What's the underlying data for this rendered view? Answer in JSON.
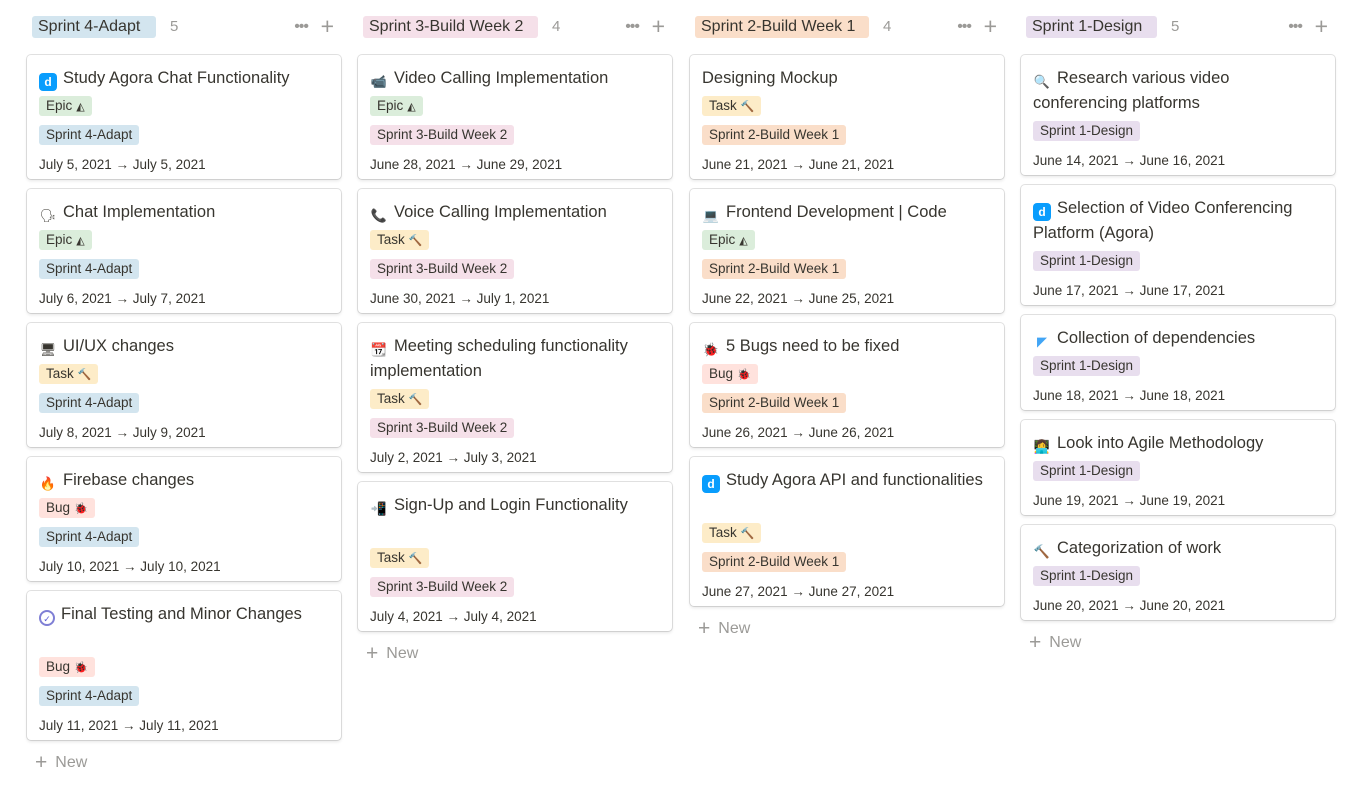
{
  "colors": {
    "sprint4": "#d3e5ef",
    "sprint3": "#f5e0e9",
    "sprint2": "#fadec9",
    "sprint1": "#e8deee",
    "epic": "#dbeddb",
    "task": "#fdecc8",
    "bug": "#ffe2dd"
  },
  "columns": [
    {
      "title": "Sprint 4-Adapt",
      "count": "5",
      "more_label": "•••",
      "add_label": "+",
      "new_label": "New",
      "cards": [
        {
          "icon": "agora-logo-icon",
          "glyph": "",
          "title": "Study Agora Chat Functionality",
          "tags": [
            {
              "label": "Epic",
              "glyph": "◭",
              "kind": "epic"
            },
            {
              "label": "Sprint 4-Adapt",
              "glyph": "",
              "kind": "sprint4"
            }
          ],
          "date": "July 5, 2021 → July 5, 2021"
        },
        {
          "icon": "speaking-head-icon",
          "glyph": "🗣",
          "title": "Chat Implementation",
          "tags": [
            {
              "label": "Epic",
              "glyph": "◭",
              "kind": "epic"
            },
            {
              "label": "Sprint 4-Adapt",
              "glyph": "",
              "kind": "sprint4"
            }
          ],
          "date": "July 6, 2021 → July 7, 2021"
        },
        {
          "icon": "desktop-computer-icon",
          "glyph": "🖥",
          "title": "UI/UX changes",
          "tags": [
            {
              "label": "Task",
              "glyph": "🔨",
              "kind": "task"
            },
            {
              "label": "Sprint 4-Adapt",
              "glyph": "",
              "kind": "sprint4"
            }
          ],
          "date": "July 8, 2021 → July 9, 2021"
        },
        {
          "icon": "firebase-flame-icon",
          "glyph": "🔥",
          "title": "Firebase changes",
          "tags": [
            {
              "label": "Bug",
              "glyph": "🐞",
              "kind": "bug"
            },
            {
              "label": "Sprint 4-Adapt",
              "glyph": "",
              "kind": "sprint4"
            }
          ],
          "date": "July 10, 2021 → July 10, 2021"
        },
        {
          "icon": "check-circle-icon",
          "glyph": "✓",
          "title": "Final Testing and Minor Changes",
          "tags": [
            {
              "label": "Bug",
              "glyph": "🐞",
              "kind": "bug"
            },
            {
              "label": "Sprint 4-Adapt",
              "glyph": "",
              "kind": "sprint4"
            }
          ],
          "date": "July 11, 2021 → July 11, 2021"
        }
      ]
    },
    {
      "title": "Sprint 3-Build Week 2",
      "count": "4",
      "more_label": "•••",
      "add_label": "+",
      "new_label": "New",
      "cards": [
        {
          "icon": "video-camera-icon",
          "glyph": "📹",
          "title": "Video Calling Implementation",
          "tags": [
            {
              "label": "Epic",
              "glyph": "◭",
              "kind": "epic"
            },
            {
              "label": "Sprint 3-Build Week 2",
              "glyph": "",
              "kind": "sprint3"
            }
          ],
          "date": "June 28, 2021 → June 29, 2021"
        },
        {
          "icon": "telephone-icon",
          "glyph": "📞",
          "title": "Voice Calling Implementation",
          "tags": [
            {
              "label": "Task",
              "glyph": "🔨",
              "kind": "task"
            },
            {
              "label": "Sprint 3-Build Week 2",
              "glyph": "",
              "kind": "sprint3"
            }
          ],
          "date": "June 30, 2021 → July 1, 2021"
        },
        {
          "icon": "calendar-icon",
          "glyph": "📆",
          "title": "Meeting scheduling functionality implementation",
          "tags": [
            {
              "label": "Task",
              "glyph": "🔨",
              "kind": "task"
            },
            {
              "label": "Sprint 3-Build Week 2",
              "glyph": "",
              "kind": "sprint3"
            }
          ],
          "date": "July 2, 2021 → July 3, 2021"
        },
        {
          "icon": "mobile-arrow-icon",
          "glyph": "📲",
          "title": "Sign-Up and Login Functionality",
          "tags": [
            {
              "label": "Task",
              "glyph": "🔨",
              "kind": "task"
            },
            {
              "label": "Sprint 3-Build Week 2",
              "glyph": "",
              "kind": "sprint3"
            }
          ],
          "date": "July 4, 2021 → July 4, 2021"
        }
      ]
    },
    {
      "title": "Sprint 2-Build Week 1",
      "count": "4",
      "more_label": "•••",
      "add_label": "+",
      "new_label": "New",
      "cards": [
        {
          "icon": "",
          "glyph": "",
          "title": "Designing Mockup",
          "tags": [
            {
              "label": "Task",
              "glyph": "🔨",
              "kind": "task"
            },
            {
              "label": "Sprint 2-Build Week 1",
              "glyph": "",
              "kind": "sprint2"
            }
          ],
          "date": "June 21, 2021 → June 21, 2021"
        },
        {
          "icon": "laptop-icon",
          "glyph": "💻",
          "title": "Frontend Development | Code",
          "tags": [
            {
              "label": "Epic",
              "glyph": "◭",
              "kind": "epic"
            },
            {
              "label": "Sprint 2-Build Week 1",
              "glyph": "",
              "kind": "sprint2"
            }
          ],
          "date": "June 22, 2021 → June 25, 2021"
        },
        {
          "icon": "ladybug-icon",
          "glyph": "🐞",
          "title": "5 Bugs need to be fixed",
          "tags": [
            {
              "label": "Bug",
              "glyph": "🐞",
              "kind": "bug"
            },
            {
              "label": "Sprint 2-Build Week 1",
              "glyph": "",
              "kind": "sprint2"
            }
          ],
          "date": "June 26, 2021 → June 26, 2021"
        },
        {
          "icon": "agora-logo-icon",
          "glyph": "",
          "title": "Study Agora API and functionalities",
          "tags": [
            {
              "label": "Task",
              "glyph": "🔨",
              "kind": "task"
            },
            {
              "label": "Sprint 2-Build Week 1",
              "glyph": "",
              "kind": "sprint2"
            }
          ],
          "date": "June 27, 2021 → June 27, 2021"
        }
      ]
    },
    {
      "title": "Sprint 1-Design",
      "count": "5",
      "more_label": "•••",
      "add_label": "+",
      "new_label": "New",
      "cards": [
        {
          "icon": "magnifying-glass-icon",
          "glyph": "🔍",
          "title": "Research various video conferencing platforms",
          "tags": [
            {
              "label": "Sprint 1-Design",
              "glyph": "",
              "kind": "sprint1"
            }
          ],
          "date": "June 14, 2021 → June 16, 2021"
        },
        {
          "icon": "agora-logo-icon",
          "glyph": "",
          "title": "Selection of Video Conferencing Platform (Agora)",
          "tags": [
            {
              "label": "Sprint 1-Design",
              "glyph": "",
              "kind": "sprint1"
            }
          ],
          "date": "June 17, 2021 → June 17, 2021"
        },
        {
          "icon": "flutter-logo-icon",
          "glyph": "◤",
          "title": "Collection of dependencies",
          "tags": [
            {
              "label": "Sprint 1-Design",
              "glyph": "",
              "kind": "sprint1"
            }
          ],
          "date": "June 18, 2021 → June 18, 2021"
        },
        {
          "icon": "technologist-icon",
          "glyph": "👩‍💻",
          "title": "Look into Agile Methodology",
          "tags": [
            {
              "label": "Sprint 1-Design",
              "glyph": "",
              "kind": "sprint1"
            }
          ],
          "date": "June 19, 2021 → June 19, 2021"
        },
        {
          "icon": "hammer-icon",
          "glyph": "🔨",
          "title": "Categorization of work",
          "tags": [
            {
              "label": "Sprint 1-Design",
              "glyph": "",
              "kind": "sprint1"
            }
          ],
          "date": "June 20, 2021 → June 20, 2021"
        }
      ]
    }
  ]
}
